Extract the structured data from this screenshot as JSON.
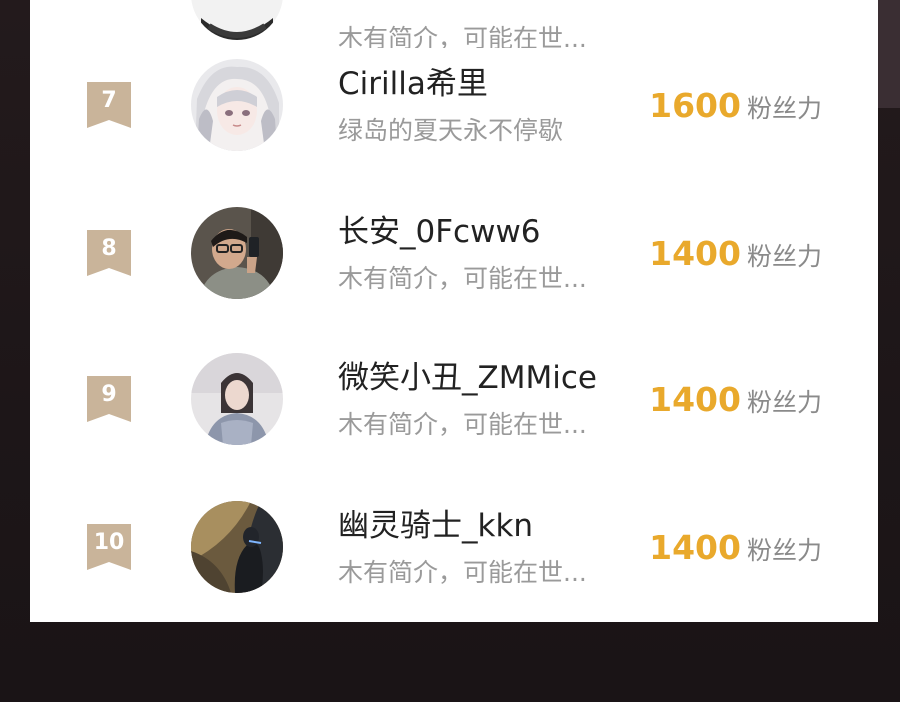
{
  "ranking": {
    "partial_top": {
      "bio": "木有简介，可能在世..."
    },
    "rows": [
      {
        "rank": "7",
        "name": "Cirilla希里",
        "bio": "绿岛的夏天永不停歇",
        "score": "1600",
        "unit": "粉丝力",
        "avatar": "avatar-anime-silver-hair"
      },
      {
        "rank": "8",
        "name": "长安_0Fcww6",
        "bio": "木有简介，可能在世...",
        "score": "1400",
        "unit": "粉丝力",
        "avatar": "avatar-selfie-glasses"
      },
      {
        "rank": "9",
        "name": "微笑小丑_ZMMice",
        "bio": "木有简介，可能在世...",
        "score": "1400",
        "unit": "粉丝力",
        "avatar": "avatar-portrait"
      },
      {
        "rank": "10",
        "name": "幽灵骑士_kkn",
        "bio": "木有简介，可能在世...",
        "score": "1400",
        "unit": "粉丝力",
        "avatar": "avatar-dark-knight"
      }
    ]
  },
  "colors": {
    "badge": "#c9b49a",
    "score": "#e9a92c",
    "name": "#222222",
    "bio": "#9a9a9a"
  }
}
